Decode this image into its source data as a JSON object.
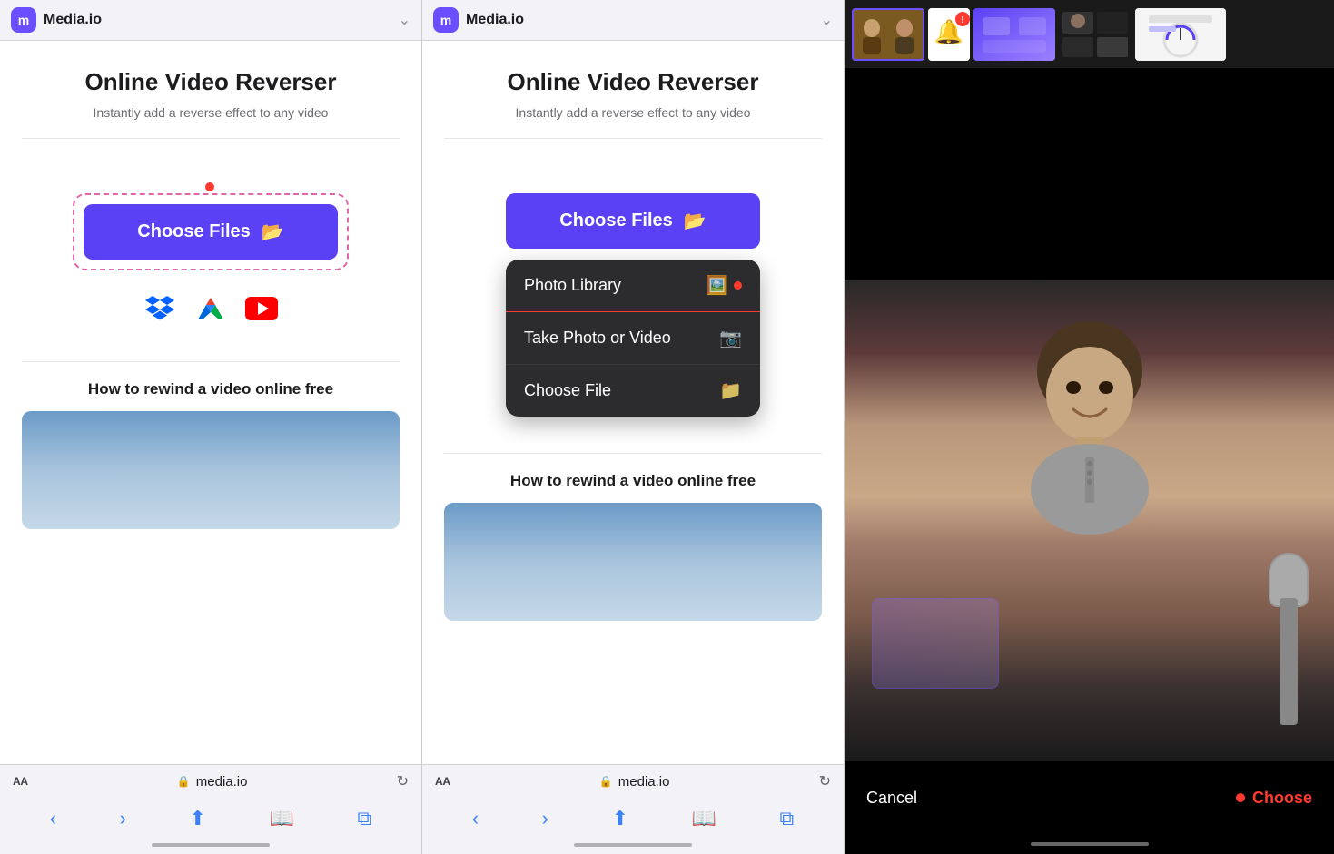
{
  "panel1": {
    "brand": "Media.io",
    "logo_letter": "m",
    "title": "Online Video Reverser",
    "subtitle": "Instantly add a reverse effect to any video",
    "choose_files_label": "Choose Files",
    "how_to_title": "How to rewind a video online free",
    "address_url": "media.io",
    "services": [
      "dropbox",
      "google-drive",
      "youtube"
    ]
  },
  "panel2": {
    "brand": "Media.io",
    "logo_letter": "m",
    "title": "Online Video Reverser",
    "subtitle": "Instantly add a reverse effect to any video",
    "choose_files_label": "Choose Files",
    "how_to_title": "How to rewind a video online free",
    "address_url": "media.io",
    "dropdown": {
      "items": [
        {
          "label": "Photo Library",
          "icon": "🖼️"
        },
        {
          "label": "Take Photo or Video",
          "icon": "📷"
        },
        {
          "label": "Choose File",
          "icon": "📁"
        }
      ]
    }
  },
  "video_panel": {
    "cancel_label": "Cancel",
    "choose_label": "Choose"
  },
  "icons": {
    "chevron_down": "∨",
    "folder": "📁",
    "lock": "🔒",
    "refresh": "↻",
    "back": "‹",
    "forward": "›",
    "share": "⬆",
    "bookmarks": "📖",
    "tabs": "⧉"
  }
}
